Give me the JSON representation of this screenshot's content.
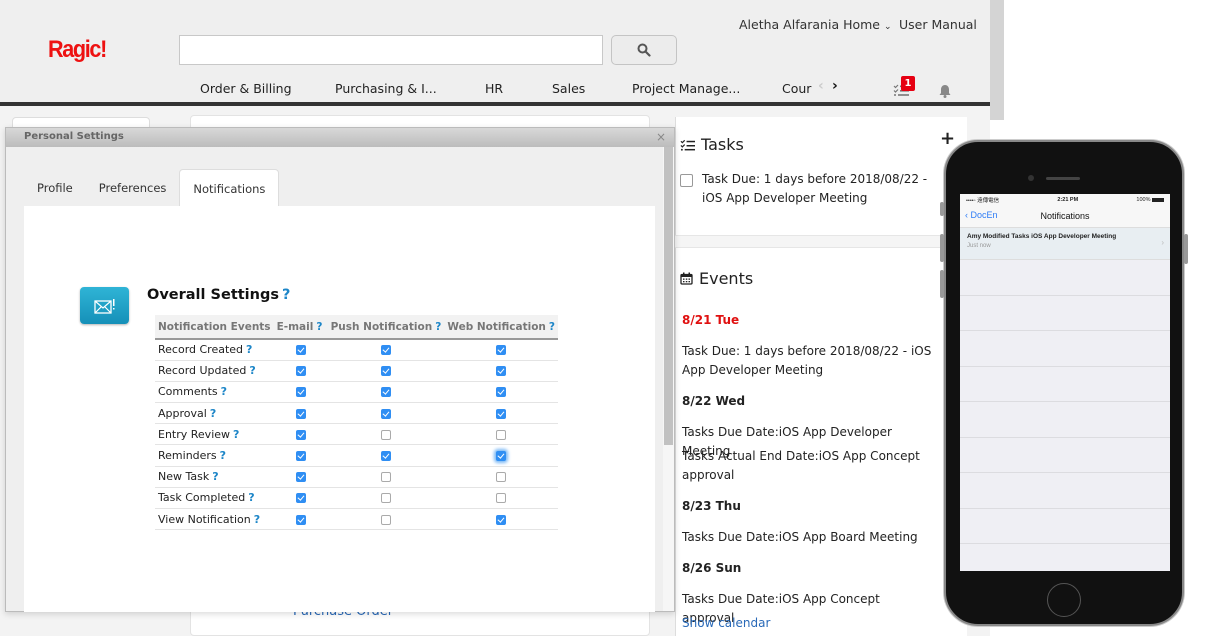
{
  "header": {
    "logo": "Ragic!",
    "search": {
      "value": "",
      "placeholder": ""
    },
    "home_link": "Aletha Alfarania Home",
    "manual_link": "User Manual",
    "nav": [
      "Order & Billing",
      "Purchasing & I...",
      "HR",
      "Sales",
      "Project Manage...",
      "Cour"
    ],
    "task_badge": "1"
  },
  "background": {
    "purchase_order_link": "Purchase Order"
  },
  "dialog": {
    "title": "Personal Settings",
    "close": "×",
    "tabs": [
      "Profile",
      "Preferences",
      "Notifications"
    ],
    "active_tab": "Notifications",
    "section_title": "Overall Settings",
    "help": "?",
    "columns": [
      "Notification Events",
      "E-mail",
      "Push Notification",
      "Web Notification"
    ],
    "rows": [
      {
        "event": "Record Created",
        "email": true,
        "push": true,
        "web": true
      },
      {
        "event": "Record Updated",
        "email": true,
        "push": true,
        "web": true
      },
      {
        "event": "Comments",
        "email": true,
        "push": true,
        "web": true
      },
      {
        "event": "Approval",
        "email": true,
        "push": true,
        "web": true
      },
      {
        "event": "Entry Review",
        "email": true,
        "push": false,
        "web": false
      },
      {
        "event": "Reminders",
        "email": true,
        "push": true,
        "web": true
      },
      {
        "event": "New Task",
        "email": true,
        "push": false,
        "web": false
      },
      {
        "event": "Task Completed",
        "email": true,
        "push": false,
        "web": false
      },
      {
        "event": "View Notification",
        "email": true,
        "push": false,
        "web": true
      }
    ]
  },
  "tasks": {
    "title": "Tasks",
    "add": "+",
    "items": [
      "Task Due: 1 days before 2018/08/22 - iOS App Developer Meeting"
    ]
  },
  "events": {
    "title": "Events",
    "groups": [
      {
        "date": "8/21 Tue",
        "today": true,
        "items": [
          "Task Due: 1 days before 2018/08/22 - iOS App Developer Meeting"
        ]
      },
      {
        "date": "8/22 Wed",
        "today": false,
        "items": [
          "Tasks Due Date:iOS App Developer Meeting",
          "Tasks Actual End Date:iOS App Concept approval"
        ]
      },
      {
        "date": "8/23 Thu",
        "today": false,
        "items": [
          "Tasks Due Date:iOS App Board Meeting"
        ]
      },
      {
        "date": "8/26 Sun",
        "today": false,
        "items": [
          "Tasks Due Date:iOS App Concept approval"
        ]
      }
    ],
    "show_calendar": "Show calendar"
  },
  "phone": {
    "carrier": "••••◦ 遠傳電信",
    "time": "2:21 PM",
    "battery": "100%",
    "back": "DocEn",
    "title": "Notifications",
    "notification": {
      "text": "Amy Modified Tasks iOS App Developer Meeting",
      "time": "Just now"
    }
  }
}
